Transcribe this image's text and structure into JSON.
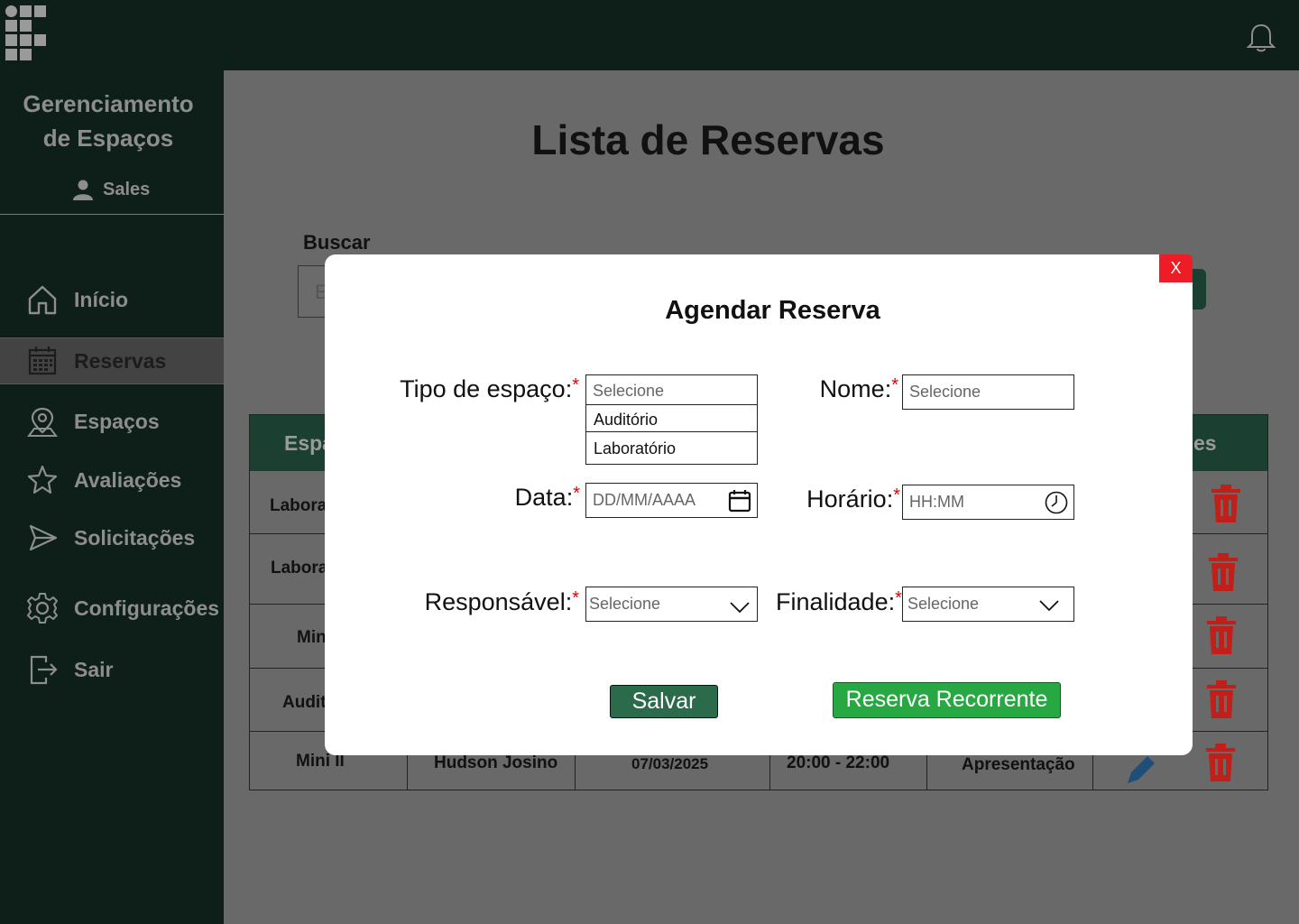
{
  "sidebar": {
    "app_title_line1": "Gerenciamento",
    "app_title_line2": "de Espaços",
    "user_name": "Sales",
    "items": [
      {
        "label": "Início",
        "icon": "home-icon"
      },
      {
        "label": "Reservas",
        "icon": "calendar-icon",
        "active": true
      },
      {
        "label": "Espaços",
        "icon": "map-pin-icon"
      },
      {
        "label": "Avaliações",
        "icon": "star-icon"
      },
      {
        "label": "Solicitações",
        "icon": "send-icon"
      },
      {
        "label": "Configurações",
        "icon": "gear-icon"
      },
      {
        "label": "Sair",
        "icon": "logout-icon"
      }
    ]
  },
  "main": {
    "title": "Lista de Reservas",
    "search_label": "Buscar",
    "search_placeholder_visible": "E",
    "table": {
      "header_visible_left": "Espa",
      "header_visible_right": "es",
      "rows": [
        {
          "espaco": "Laborat"
        },
        {
          "espaco": "Labora"
        },
        {
          "espaco": "Min"
        },
        {
          "espaco": "Audit"
        },
        {
          "espaco": "Mini II",
          "responsavel": "Hudson Josino",
          "data": "07/03/2025",
          "horario": "20:00 - 22:00",
          "finalidade": "Apresentação"
        }
      ]
    }
  },
  "modal": {
    "title": "Agendar Reserva",
    "close_label": "X",
    "tipo_label": "Tipo de espaço:",
    "tipo_placeholder": "Selecione",
    "tipo_options": [
      "Auditório",
      "Laboratório"
    ],
    "nome_label": "Nome:",
    "nome_placeholder": "Selecione",
    "data_label": "Data:",
    "data_placeholder": "DD/MM/AAAA",
    "horario_label": "Horário:",
    "horario_placeholder": "HH:MM",
    "responsavel_label": "Responsável:",
    "responsavel_placeholder": "Selecione",
    "finalidade_label": "Finalidade:",
    "finalidade_placeholder": "Selecione",
    "required_mark": "*",
    "save_label": "Salvar",
    "recurrent_label": "Reserva Recorrente"
  },
  "colors": {
    "dark_green": "#0e1f1a",
    "table_header": "#1b3f30",
    "save_button": "#2c6a4c",
    "recurrent_button": "#27a843",
    "close_button": "#ee1c24",
    "delete_icon": "#c0201a",
    "overlay": "#696969"
  }
}
